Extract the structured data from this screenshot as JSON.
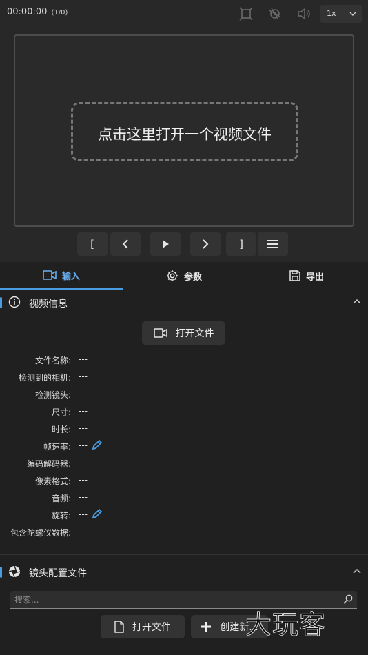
{
  "topbar": {
    "timecode": "00:00:00",
    "frame_count": "(1/0)",
    "speed": "1x"
  },
  "preview": {
    "dropzone_text": "点击这里打开一个视频文件"
  },
  "transport": {
    "mark_in": "[",
    "mark_out": "]"
  },
  "tabs": [
    {
      "label": "输入",
      "icon": "camera-icon",
      "active": true
    },
    {
      "label": "参数",
      "icon": "gear-icon",
      "active": false
    },
    {
      "label": "导出",
      "icon": "save-icon",
      "active": false
    }
  ],
  "video_info": {
    "title": "视频信息",
    "open_button": "打开文件",
    "rows": [
      {
        "label": "文件名称:",
        "value": "---"
      },
      {
        "label": "检测到的相机:",
        "value": "---"
      },
      {
        "label": "检测镜头:",
        "value": "---"
      },
      {
        "label": "尺寸:",
        "value": "---"
      },
      {
        "label": "时长:",
        "value": "---"
      },
      {
        "label": "帧速率:",
        "value": "---"
      },
      {
        "label": "编码解码器:",
        "value": "---"
      },
      {
        "label": "像素格式:",
        "value": "---"
      },
      {
        "label": "音频:",
        "value": "---"
      },
      {
        "label": "旋转:",
        "value": "---"
      },
      {
        "label": "包含陀螺仪数据:",
        "value": "---"
      }
    ]
  },
  "lens_profile": {
    "title": "镜头配置文件",
    "search_placeholder": "搜索...",
    "open_button": "打开文件",
    "create_button": "创建新..."
  },
  "watermark": "大玩客",
  "colors": {
    "accent": "#4a9be0",
    "background": "#282828",
    "panel": "#202020",
    "button": "#333333"
  }
}
